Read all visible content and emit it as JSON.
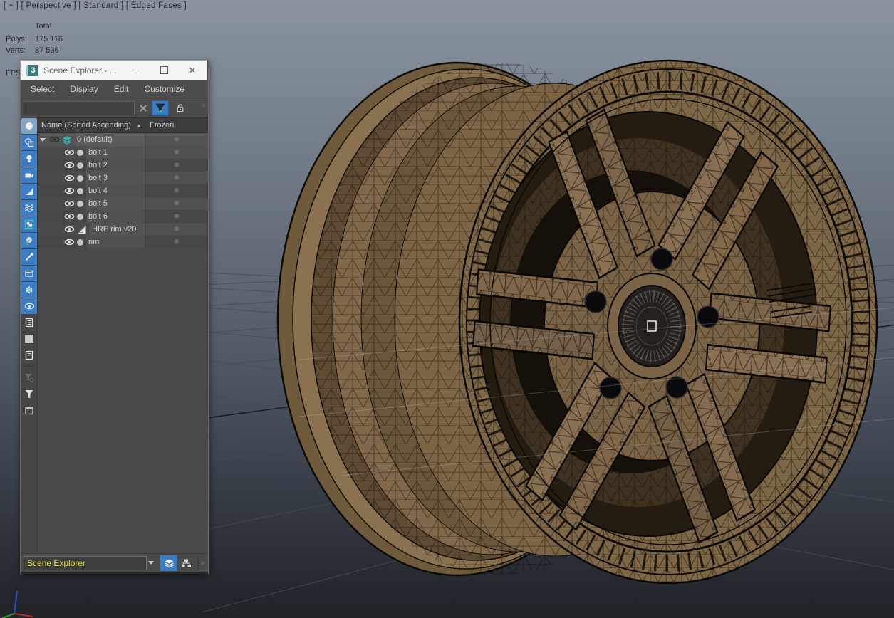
{
  "viewport": {
    "label": "[ + ] [ Perspective ] [ Standard ] [ Edged Faces ]",
    "stats": {
      "total_label": "Total",
      "polys_label": "Polys:",
      "polys_value": "175 116",
      "verts_label": "Verts:",
      "verts_value": "87 536",
      "fps_label": "FPS"
    },
    "colors": {
      "bg_top": "#87909d",
      "bg_bottom": "#1f2227",
      "grid_line": "#454c58",
      "wheel_tan": "#8a7152",
      "wheel_dark_tan": "#6b5638",
      "wireframe": "#0c0a07",
      "axis_x": "#c03030",
      "axis_y": "#3a9a3a",
      "axis_z": "#3050c0"
    }
  },
  "window": {
    "logo": "3",
    "title": "Scene Explorer - ...",
    "controls": {
      "close": "✕"
    },
    "menus": [
      "Select",
      "Display",
      "Edit",
      "Customize"
    ],
    "search": {
      "value": "",
      "overflow": "»"
    },
    "columns": {
      "name": "Name (Sorted Ascending)",
      "sort_indicator": "▲",
      "frozen": "Frozen"
    },
    "frozen_glyph": "❄",
    "rows": [
      {
        "label": "0 (default)",
        "type": "layer",
        "expanded": true
      },
      {
        "label": "bolt 1",
        "type": "object"
      },
      {
        "label": "bolt 2",
        "type": "object"
      },
      {
        "label": "bolt 3",
        "type": "object"
      },
      {
        "label": "bolt 4",
        "type": "object"
      },
      {
        "label": "bolt 5",
        "type": "object"
      },
      {
        "label": "bolt 6",
        "type": "object"
      },
      {
        "label": "HRE rim v20",
        "type": "helper"
      },
      {
        "label": "rim",
        "type": "object"
      }
    ],
    "toolbar_icons": [
      "geometry",
      "shapes",
      "lights",
      "cameras",
      "helpers",
      "space-warps",
      "groups",
      "xrefs",
      "bones",
      "containers",
      "frozen-objects",
      "hidden-objects",
      "list-view",
      "blank",
      "properties-view",
      "advanced-filter",
      "filter",
      "container"
    ],
    "bottom": {
      "selector_value": "Scene Explorer",
      "accent": "#3a7cc4"
    }
  }
}
